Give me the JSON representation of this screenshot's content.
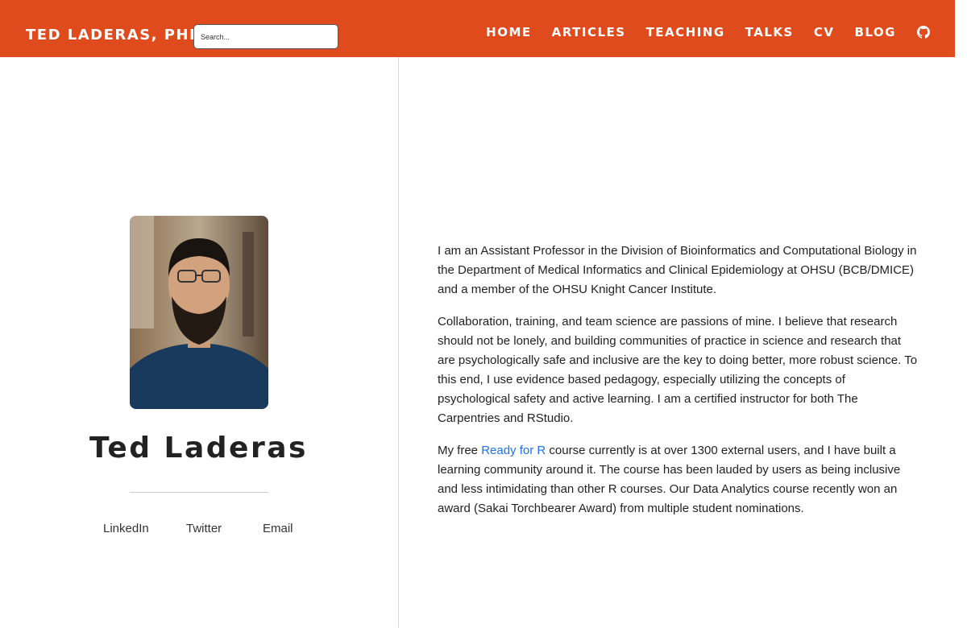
{
  "navbar": {
    "brand": "Ted Laderas, PhD",
    "search_placeholder": "Search...",
    "links": [
      "Home",
      "Articles",
      "Teaching",
      "Talks",
      "CV",
      "Blog"
    ],
    "icon": "github-icon",
    "background_color": "#df4b1d"
  },
  "sidebar": {
    "avatar_alt": "Ted Laderas",
    "name": "Ted Laderas",
    "social": [
      "LinkedIn",
      "Twitter",
      "Email"
    ]
  },
  "about": {
    "p1": "I am an Assistant Professor in the Division of Bioinformatics and Computational Biology in the Department of Medical Informatics and Clinical Epidemiology at OHSU (BCB/DMICE) and a member of the OHSU Knight Cancer Institute.",
    "p2": "Collaboration, training, and team science are passions of mine. I believe that research should not be lonely, and building communities of practice in science and research that are psychologically safe and inclusive are the key to doing better, more robust science. To this end, I use evidence based pedagogy, especially utilizing the concepts of psychological safety and active learning. I am a certified instructor for both The Carpentries and RStudio.",
    "p3_before": "My free ",
    "p3_link": "Ready for R",
    "p3_after": " course currently is at over 1300 external users, and I have built a learning community around it. The course has been lauded by users as being inclusive and less intimidating than other R courses. Our Data Analytics course recently won an award (Sakai Torchbearer Award) from multiple student nominations.",
    "link_color": "#1a73e8"
  }
}
